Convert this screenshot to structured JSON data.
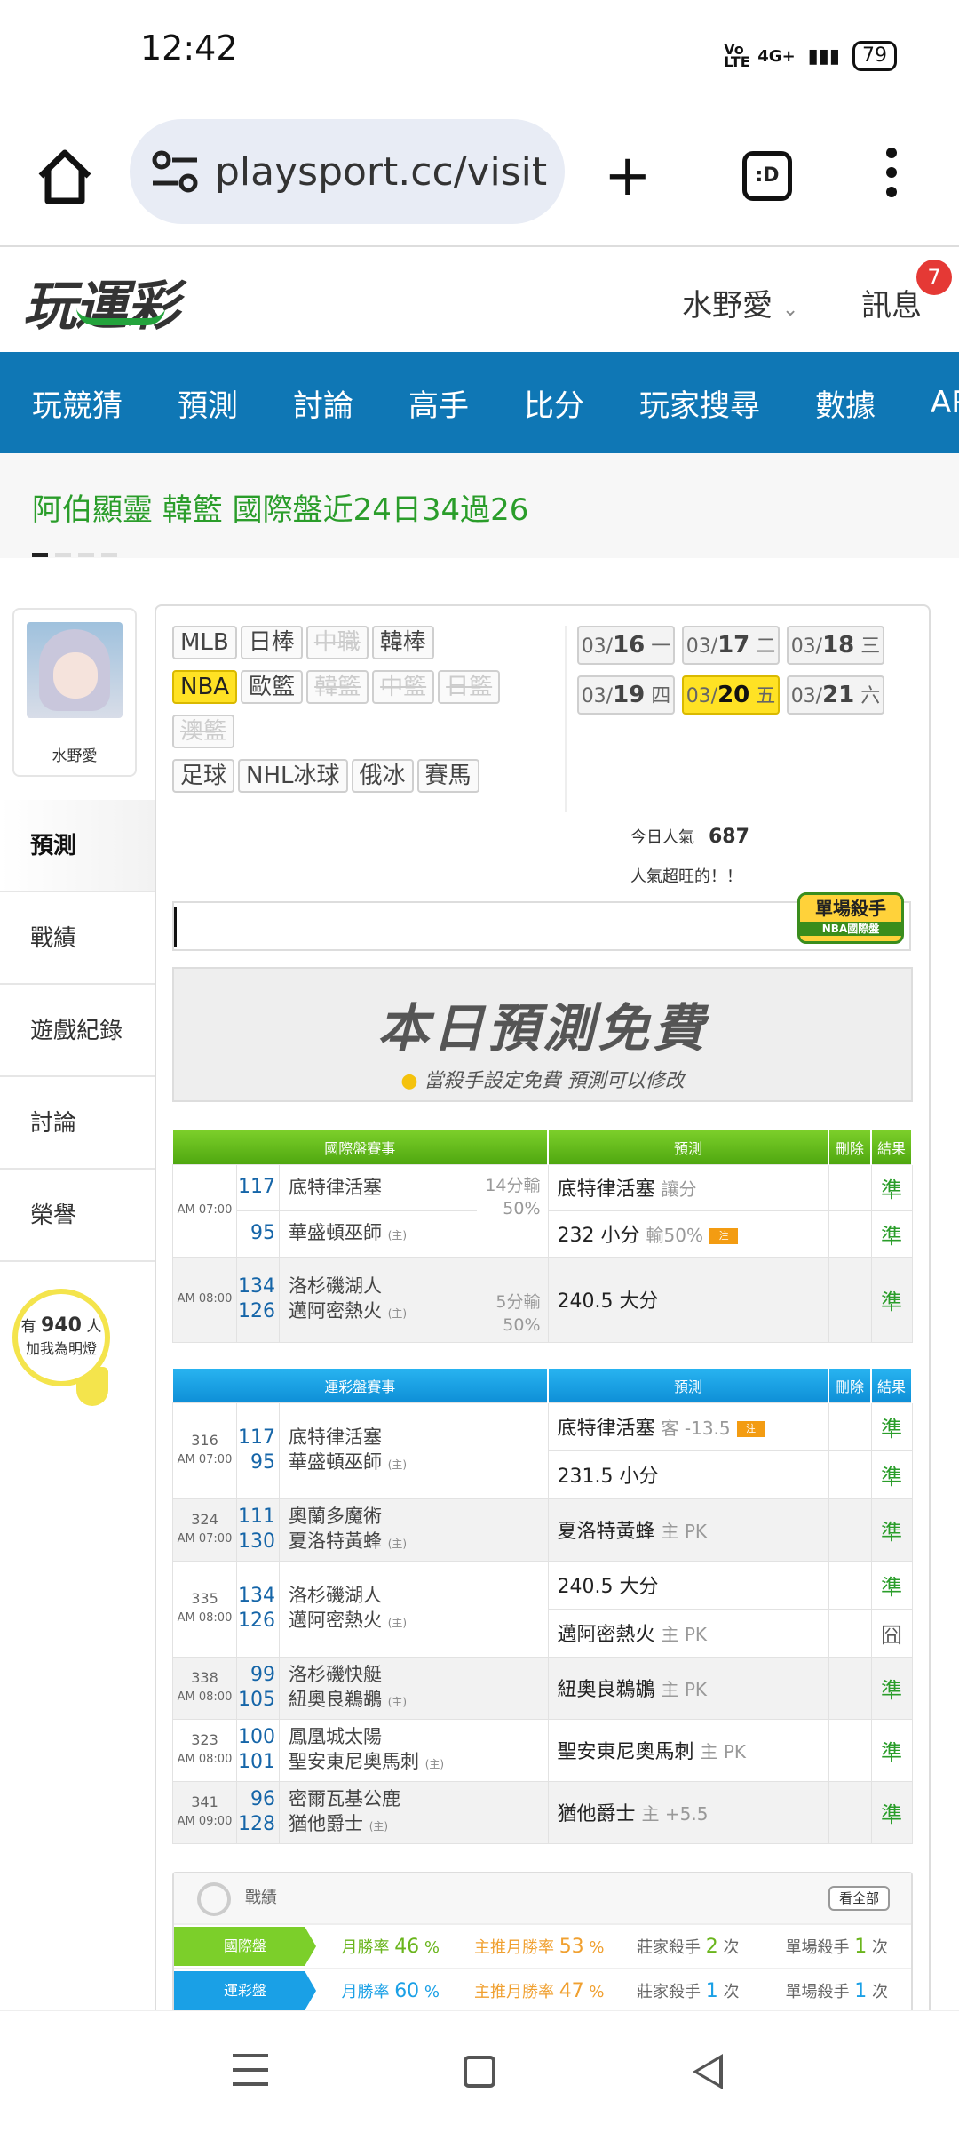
{
  "status": {
    "time": "12:42",
    "network": "4G+",
    "volte": "Vo LTE",
    "battery": "79"
  },
  "browser": {
    "url": "playsport.cc/visit",
    "tabs_label": ":D"
  },
  "site": {
    "logo": "玩運彩",
    "user": "水野愛",
    "messages_label": "訊息",
    "messages_count": "7"
  },
  "nav": [
    "玩競猜",
    "預測",
    "討論",
    "高手",
    "比分",
    "玩家搜尋",
    "數據",
    "APP"
  ],
  "marquee": "阿伯顯靈 韓籃 國際盤近24日34過26",
  "sidebar": {
    "name": "水野愛",
    "menu": [
      "預測",
      "戰績",
      "遊戲紀錄",
      "討論",
      "榮譽"
    ],
    "bulb_prefix": "有",
    "bulb_count": "940",
    "bulb_suffix": "人",
    "bulb_text": "加我為明燈"
  },
  "sports": {
    "row1": [
      "MLB",
      "日棒",
      "中職",
      "韓棒"
    ],
    "row2": [
      "NBA",
      "歐籃",
      "韓籃",
      "中籃",
      "日籃"
    ],
    "row3": [
      "澳籃"
    ],
    "row4": [
      "足球",
      "NHL冰球",
      "俄冰",
      "賽馬"
    ]
  },
  "dates": [
    {
      "md": "03/",
      "d": "16",
      "w": "一"
    },
    {
      "md": "03/",
      "d": "17",
      "w": "二"
    },
    {
      "md": "03/",
      "d": "18",
      "w": "三"
    },
    {
      "md": "03/",
      "d": "19",
      "w": "四"
    },
    {
      "md": "03/",
      "d": "20",
      "w": "五"
    },
    {
      "md": "03/",
      "d": "21",
      "w": "六"
    }
  ],
  "popularity": {
    "label": "今日人氣",
    "value": "687",
    "note": "人氣超旺的！！"
  },
  "killer_badge": {
    "title": "單場殺手",
    "sub": "NBA國際盤"
  },
  "free_banner": {
    "title": "本日預測免費",
    "subtitle": "當殺手設定免費  預測可以修改"
  },
  "intl_table": {
    "headers": [
      "國際盤賽事",
      "預測",
      "刪除",
      "結果"
    ],
    "g1": {
      "time": "AM 07:00",
      "s1": "117",
      "t1": "底特律活塞",
      "s2": "95",
      "t2": "華盛頓巫師",
      "home": "(主)",
      "h1": "14分輸",
      "h2": "50%",
      "p1": "底特律活塞",
      "p1s": "讓分",
      "r1": "準",
      "p2": "232 小分",
      "p2s": "輸50%",
      "p2b": "注",
      "r2": "準"
    },
    "g2": {
      "time": "AM 08:00",
      "s1": "134",
      "t1": "洛杉磯湖人",
      "s2": "126",
      "t2": "邁阿密熱火",
      "home": "(主)",
      "h1": "5分輸",
      "h2": "50%",
      "p1": "240.5 大分",
      "r1": "準"
    }
  },
  "tw_table": {
    "headers": [
      "運彩盤賽事",
      "預測",
      "刪除",
      "結果"
    ],
    "rows": [
      {
        "no": "316",
        "time": "AM 07:00",
        "s1": "117",
        "t1": "底特律活塞",
        "s2": "95",
        "t2": "華盛頓巫師",
        "home": "(主)",
        "p1": "底特律活塞",
        "p1s": "客 -13.5",
        "p1b": "注",
        "r1": "準",
        "p2": "231.5 小分",
        "r2": "準"
      },
      {
        "no": "324",
        "time": "AM 07:00",
        "s1": "111",
        "t1": "奧蘭多魔術",
        "s2": "130",
        "t2": "夏洛特黃蜂",
        "home": "(主)",
        "p1": "夏洛特黃蜂",
        "p1s": "主 PK",
        "r1": "準"
      },
      {
        "no": "335",
        "time": "AM 08:00",
        "s1": "134",
        "t1": "洛杉磯湖人",
        "s2": "126",
        "t2": "邁阿密熱火",
        "home": "(主)",
        "p1": "240.5 大分",
        "r1": "準",
        "p2": "邁阿密熱火",
        "p2s": "主 PK",
        "r2": "囧"
      },
      {
        "no": "338",
        "time": "AM 08:00",
        "s1": "99",
        "t1": "洛杉磯快艇",
        "s2": "105",
        "t2": "紐奧良鵜鶘",
        "home": "(主)",
        "p1": "紐奧良鵜鶘",
        "p1s": "主 PK",
        "r1": "準"
      },
      {
        "no": "323",
        "time": "AM 08:00",
        "s1": "100",
        "t1": "鳳凰城太陽",
        "s2": "101",
        "t2": "聖安東尼奧馬刺",
        "home": "(主)",
        "p1": "聖安東尼奧馬刺",
        "p1s": "主 PK",
        "r1": "準"
      },
      {
        "no": "341",
        "time": "AM 09:00",
        "s1": "96",
        "t1": "密爾瓦基公鹿",
        "s2": "128",
        "t2": "猶他爵士",
        "home": "(主)",
        "p1": "猶他爵士",
        "p1s": "主 +5.5",
        "r1": "準"
      }
    ]
  },
  "record": {
    "title": "戰績",
    "all": "看全部",
    "rows": [
      {
        "label": "國際盤",
        "c1": "月勝率",
        "v1": "46",
        "c2": "主推月勝率",
        "v2": "53",
        "c3": "莊家殺手",
        "v3": "2",
        "c4": "單場殺手",
        "v4": "1",
        "unit_pct": "%",
        "unit_times": "次",
        "color": "#7ccf2a"
      },
      {
        "label": "運彩盤",
        "c1": "月勝率",
        "v1": "60",
        "c2": "主推月勝率",
        "v2": "47",
        "c3": "莊家殺手",
        "v3": "1",
        "c4": "單場殺手",
        "v4": "1",
        "unit_pct": "%",
        "unit_times": "次",
        "color": "#1aa0e6"
      }
    ]
  }
}
